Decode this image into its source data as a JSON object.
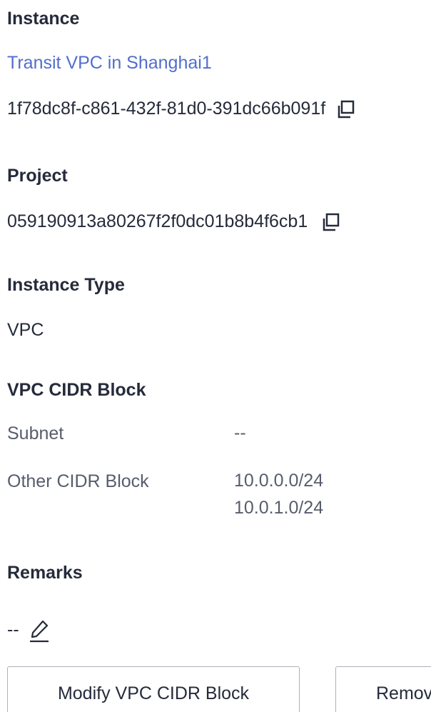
{
  "instance": {
    "heading": "Instance",
    "name_link": "Transit VPC in Shanghai1",
    "id": "1f78dc8f-c861-432f-81d0-391dc66b091f"
  },
  "project": {
    "heading": "Project",
    "id": "059190913a80267f2f0dc01b8b4f6cb1"
  },
  "instance_type": {
    "heading": "Instance Type",
    "value": "VPC"
  },
  "vpc_cidr": {
    "heading": "VPC CIDR Block",
    "subnet_label": "Subnet",
    "subnet_value": "--",
    "other_label": "Other CIDR Block",
    "other_values": [
      "10.0.0.0/24",
      "10.0.1.0/24"
    ]
  },
  "remarks": {
    "heading": "Remarks",
    "value": "--"
  },
  "buttons": {
    "modify_label": "Modify VPC CIDR Block",
    "remove_label": "Remov"
  },
  "icons": {
    "copy": "copy-icon",
    "edit": "edit-pencil-icon"
  },
  "colors": {
    "link": "#526ecc",
    "text": "#252b3a",
    "secondary_text": "#575d6c",
    "border": "#adb0b8"
  }
}
